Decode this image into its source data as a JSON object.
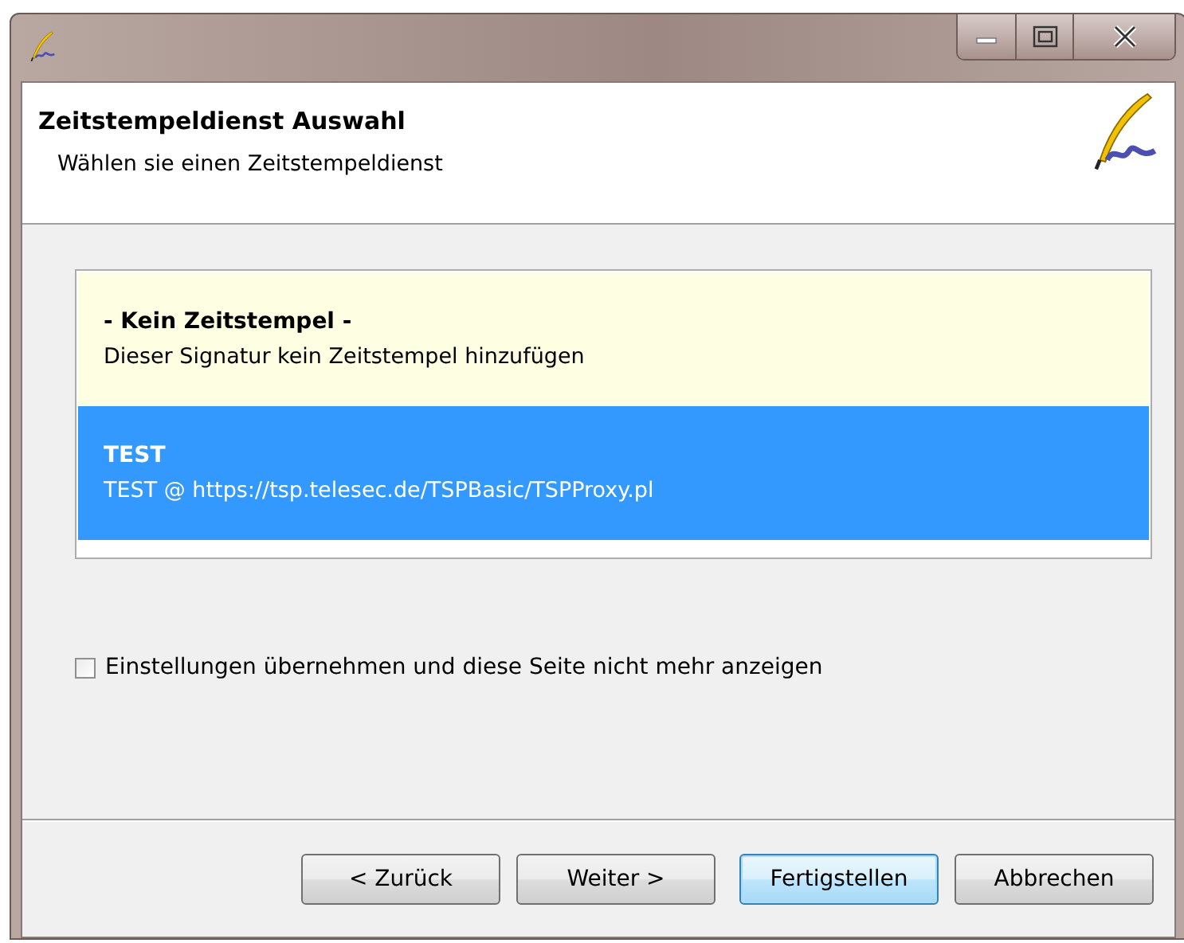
{
  "header": {
    "title": "Zeitstempeldienst Auswahl",
    "subtitle": "Wählen sie einen Zeitstempeldienst"
  },
  "services": [
    {
      "name": "- Kein Zeitstempel -",
      "detail": "Dieser Signatur kein Zeitstempel hinzufügen",
      "selected": false
    },
    {
      "name": "TEST",
      "detail": "TEST @ https://tsp.telesec.de/TSPBasic/TSPProxy.pl",
      "selected": true
    }
  ],
  "remember": {
    "label": "Einstellungen übernehmen und diese Seite nicht mehr anzeigen",
    "checked": false
  },
  "buttons": [
    {
      "label": "< Zurück",
      "default": false
    },
    {
      "label": "Weiter >",
      "default": false
    },
    {
      "label": "Fertigstellen",
      "default": true
    },
    {
      "label": "Abbrechen",
      "default": false
    }
  ]
}
